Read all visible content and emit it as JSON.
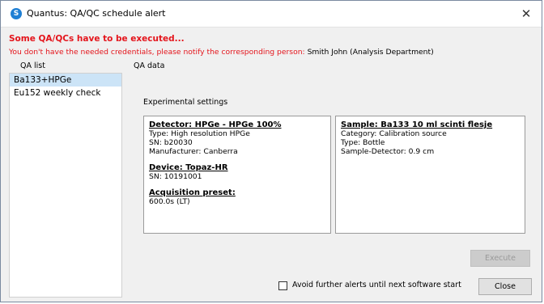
{
  "window": {
    "title": "Quantus: QA/QC schedule alert",
    "icon_letter": "S",
    "close_glyph": "✕"
  },
  "alert": {
    "headline": "Some QA/QCs have to be executed...",
    "message_red": "You don't have the needed credentials, please notify the corresponding person:",
    "contact": "Smith John (Analysis Department)"
  },
  "qa_list": {
    "label": "QA list",
    "items": [
      "Ba133+HPGe",
      "Eu152 weekly check"
    ],
    "selected_index": 0
  },
  "qa_data": {
    "label": "QA data",
    "section_label": "Experimental settings",
    "detector": {
      "heading": "Detector: HPGe - HPGe 100%",
      "lines": [
        "Type: High resolution HPGe",
        "SN: b20030",
        "Manufacturer: Canberra"
      ]
    },
    "device": {
      "heading": "Device: Topaz-HR",
      "lines": [
        "SN: 10191001"
      ]
    },
    "acquisition": {
      "heading": "Acquisition preset:",
      "lines": [
        "600.0s (LT)"
      ]
    },
    "sample": {
      "heading": "Sample: Ba133 10 ml scinti flesje",
      "lines": [
        "Category: Calibration source",
        "Type: Bottle",
        "Sample-Detector: 0.9 cm"
      ]
    }
  },
  "buttons": {
    "execute": "Execute",
    "close": "Close"
  },
  "avoid_alerts": {
    "label": "Avoid further alerts until next software start",
    "checked": false
  },
  "colors": {
    "alert_red": "#e4141b",
    "selection": "#cce4f7",
    "app_icon": "#1f7fd4"
  }
}
